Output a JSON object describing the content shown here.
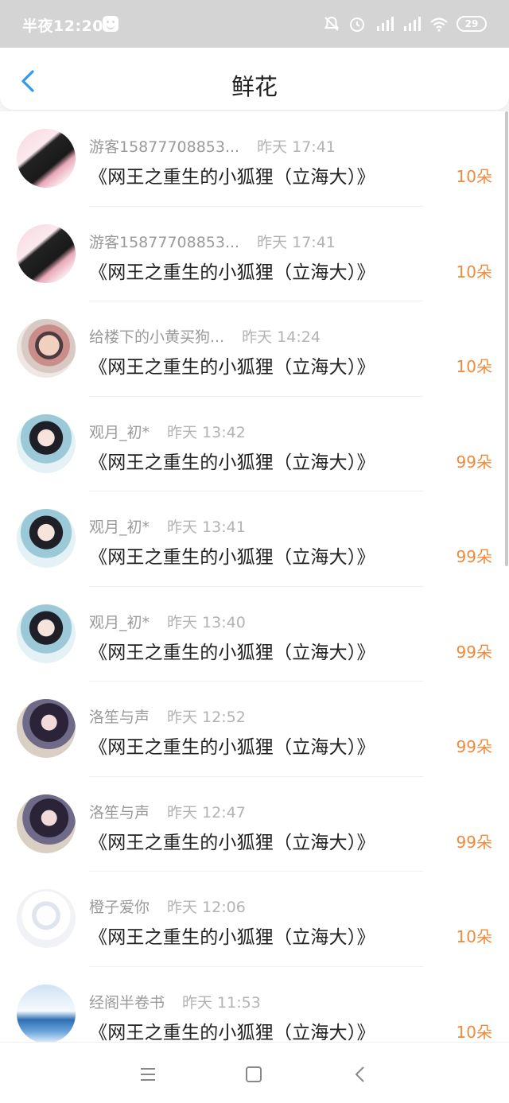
{
  "status_bar": {
    "time": "半夜12:20",
    "battery": "29"
  },
  "header": {
    "title": "鲜花"
  },
  "colors": {
    "accent_blue": "#2f9bf0",
    "count_orange": "#ef8a3c",
    "status_bar_bg": "#d4d4d4"
  },
  "rows": [
    {
      "name": "游客15877708853...",
      "time": "昨天 17:41",
      "book": "《网王之重生的小狐狸（立海大）》",
      "count": "10朵"
    },
    {
      "name": "游客15877708853...",
      "time": "昨天 17:41",
      "book": "《网王之重生的小狐狸（立海大）》",
      "count": "10朵"
    },
    {
      "name": "给楼下的小黄买狗...",
      "time": "昨天 14:24",
      "book": "《网王之重生的小狐狸（立海大）》",
      "count": "10朵"
    },
    {
      "name": "观月_初*",
      "time": "昨天 13:42",
      "book": "《网王之重生的小狐狸（立海大）》",
      "count": "99朵"
    },
    {
      "name": "观月_初*",
      "time": "昨天 13:41",
      "book": "《网王之重生的小狐狸（立海大）》",
      "count": "99朵"
    },
    {
      "name": "观月_初*",
      "time": "昨天 13:40",
      "book": "《网王之重生的小狐狸（立海大）》",
      "count": "99朵"
    },
    {
      "name": "洛笙与声",
      "time": "昨天 12:52",
      "book": "《网王之重生的小狐狸（立海大）》",
      "count": "99朵"
    },
    {
      "name": "洛笙与声",
      "time": "昨天 12:47",
      "book": "《网王之重生的小狐狸（立海大）》",
      "count": "99朵"
    },
    {
      "name": "橙子爱你",
      "time": "昨天 12:06",
      "book": "《网王之重生的小狐狸（立海大）》",
      "count": "10朵"
    },
    {
      "name": "经阁半卷书",
      "time": "昨天 11:53",
      "book": "《网王之重生的小狐狸（立海大）》",
      "count": "10朵"
    }
  ]
}
